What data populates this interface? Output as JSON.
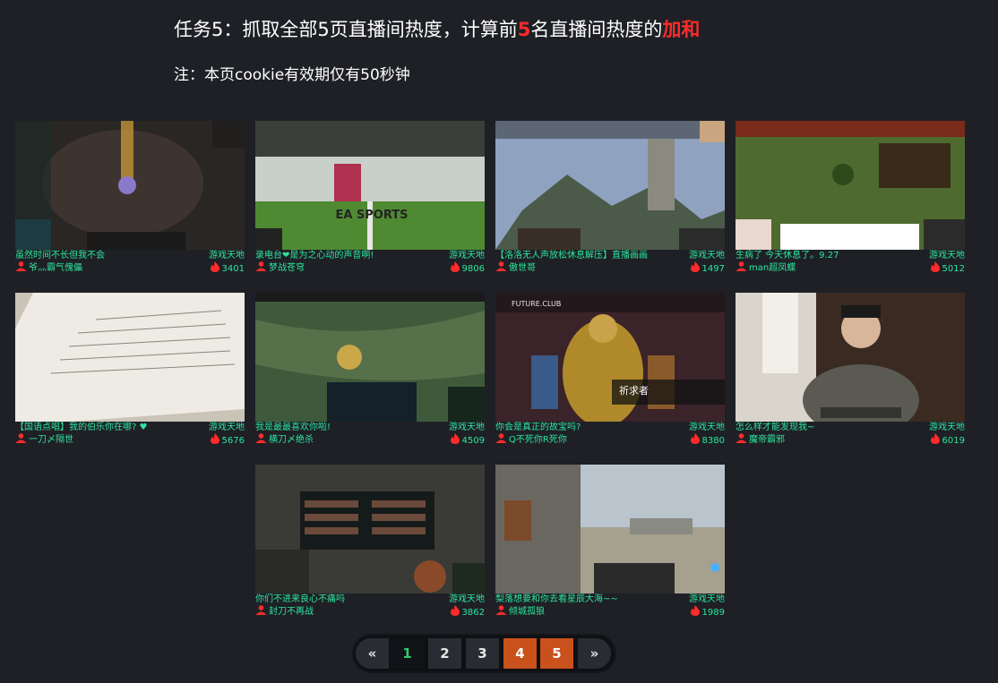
{
  "header": {
    "title_main": "任务5：抓取全部5页直播间热度，计算前",
    "title_num": "5",
    "title_mid": "名直播间热度的",
    "title_red": "加和",
    "note": "注：本页cookie有效期仅有50秒钟"
  },
  "cards": [
    {
      "title": "虽然时间不长但我不会",
      "category": "游戏天地",
      "anchor": "爷灬霸气傀儡",
      "heat": "3401"
    },
    {
      "title": "录电台❤是为之心动的声音啊!",
      "category": "游戏天地",
      "anchor": "梦战苍穹",
      "heat": "9806"
    },
    {
      "title": "【洛洛无人声放松休息解压】直播画画",
      "category": "游戏天地",
      "anchor": "傲世哥",
      "heat": "1497"
    },
    {
      "title": "生病了 今天休息了。9.27",
      "category": "游戏天地",
      "anchor": "man超凤蝶",
      "heat": "5012"
    },
    {
      "title": "【国语点唱】我的伯乐你在哪? ♥",
      "category": "游戏天地",
      "anchor": "一刀〆隔世",
      "heat": "5676"
    },
    {
      "title": "我是最最喜欢你啦!",
      "category": "游戏天地",
      "anchor": "横刀〆绝杀",
      "heat": "4509"
    },
    {
      "title": "你会是真正的故宝吗?",
      "category": "游戏天地",
      "anchor": "Q不死你R死你",
      "heat": "8380"
    },
    {
      "title": "怎么样才能发现我~",
      "category": "游戏天地",
      "anchor": "魔帝霸邪",
      "heat": "6019"
    },
    {
      "title": "你们不进来良心不痛吗",
      "category": "游戏天地",
      "anchor": "封刀不再战",
      "heat": "3862"
    },
    {
      "title": "梨落想要和你去看星辰大海~~",
      "category": "游戏天地",
      "anchor": "倾城孤狼",
      "heat": "1989"
    }
  ],
  "thumbs": {
    "sports_text": "EA SPORTS",
    "future_club": "FUTURE.CLUB",
    "future_caption": "祈求者"
  },
  "pagination": {
    "prev": "«",
    "pages": [
      "1",
      "2",
      "3",
      "4",
      "5"
    ],
    "next": "»",
    "active_page": "1",
    "highlighted_pages": [
      "4",
      "5"
    ]
  },
  "colors": {
    "background": "#1e2026",
    "accent_green": "#2ee59d",
    "title_red": "#ff2b2b",
    "pager_orange": "#c9511b"
  },
  "icons": {
    "anchor": "user-icon",
    "heat": "flame-icon"
  }
}
